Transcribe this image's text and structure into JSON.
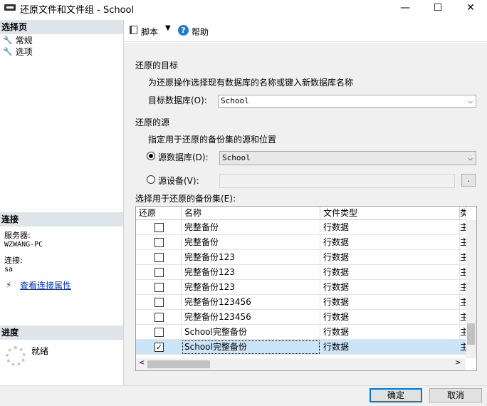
{
  "window": {
    "title": "还原文件和文件组 - School",
    "minimize": "—",
    "maximize": "☐",
    "close": "✕"
  },
  "left": {
    "select_page_header": "选择页",
    "nav": [
      "常规",
      "选项"
    ],
    "connection_header": "连接",
    "server_label": "服务器:",
    "server_value": "WZWANG-PC",
    "connection_label": "连接:",
    "connection_value": "sa",
    "view_props_link": "查看连接属性",
    "progress_header": "进度",
    "progress_status": "就绪"
  },
  "toolbar": {
    "script_label": "脚本",
    "help_label": "帮助"
  },
  "main": {
    "restore_target_title": "还原的目标",
    "restore_target_desc": "为还原操作选择现有数据库的名称或键入新数据库名称",
    "target_db_label": "目标数据库(O):",
    "target_db_value": "School",
    "restore_source_title": "还原的源",
    "restore_source_desc": "指定用于还原的备份集的源和位置",
    "source_db_label": "源数据库(D):",
    "source_db_value": "School",
    "source_device_label": "源设备(V):",
    "browse_label": ".",
    "backupset_label": "选择用于还原的备份集(E):"
  },
  "grid": {
    "headers": [
      "还原",
      "名称",
      "文件类型",
      "类"
    ],
    "rows": [
      {
        "checked": false,
        "name": "完整备份",
        "type": "行数据",
        "extra": "主"
      },
      {
        "checked": false,
        "name": "完整备份",
        "type": "行数据",
        "extra": "主"
      },
      {
        "checked": false,
        "name": "完整备份123",
        "type": "行数据",
        "extra": "主"
      },
      {
        "checked": false,
        "name": "完整备份123",
        "type": "行数据",
        "extra": "主"
      },
      {
        "checked": false,
        "name": "完整备份123",
        "type": "行数据",
        "extra": "主"
      },
      {
        "checked": false,
        "name": "完整备份123456",
        "type": "行数据",
        "extra": "主"
      },
      {
        "checked": false,
        "name": "完整备份123456",
        "type": "行数据",
        "extra": "主"
      },
      {
        "checked": false,
        "name": "School完整备份",
        "type": "行数据",
        "extra": "主"
      },
      {
        "checked": true,
        "name": "School完整备份",
        "type": "行数据",
        "extra": "主"
      }
    ],
    "selected_index": 8
  },
  "buttons": {
    "ok": "确定",
    "cancel": "取消"
  }
}
